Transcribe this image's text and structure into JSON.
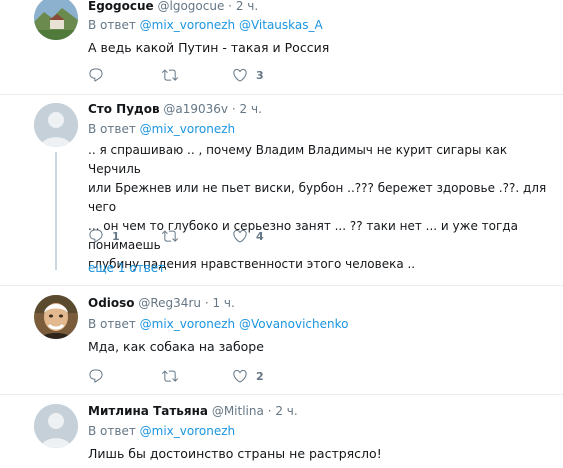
{
  "tweets": [
    {
      "name": "Egogocue",
      "handle": "@lgogocue",
      "dot": "·",
      "time": "2 ч.",
      "reply_prefix": "В ответ",
      "mentions": [
        "@mix_voronezh",
        "@Vitauskas_A"
      ],
      "text": "А ведь какой Путин - такая и Россия",
      "reply_count": "",
      "retweet_count": "",
      "like_count": "3"
    },
    {
      "name": "Сто Пудов",
      "handle": "@a19036v",
      "dot": "·",
      "time": "2 ч.",
      "reply_prefix": "В ответ",
      "mentions": [
        "@mix_voronezh"
      ],
      "text_lines": [
        ".. я спрашиваю ..  , почему Владим Владимыч не курит сигары как Черчиль",
        "или Брежнев или не пьет виски, бурбон ..??? бережет здоровье .??. для чего",
        "... он чем то глубоко и серьезно занят ... ?? таки нет ... и уже тогда понимаешь",
        "глубину падения нравственности этого человека .."
      ],
      "reply_count": "1",
      "retweet_count": "",
      "like_count": "4",
      "more_replies": "еще 1 ответ"
    },
    {
      "name": "Odioso",
      "handle": "@Reg34ru",
      "dot": "·",
      "time": "1 ч.",
      "reply_prefix": "В ответ",
      "mentions": [
        "@mix_voronezh",
        "@Vovanovichenko"
      ],
      "text": "Мда, как собака на заборе",
      "reply_count": "",
      "retweet_count": "",
      "like_count": "2"
    },
    {
      "name": "Митлина Татьяна",
      "handle": "@Mitlina",
      "dot": "·",
      "time": "2 ч.",
      "reply_prefix": "В ответ",
      "mentions": [
        "@mix_voronezh"
      ],
      "text": "Лишь бы достоинство страны не растрясло!"
    }
  ],
  "icons": {
    "reply": "reply-icon",
    "retweet": "retweet-icon",
    "like": "heart-icon"
  },
  "colors": {
    "link": "#1b95e0",
    "muted": "#657786",
    "separator": "#e6ecf0"
  }
}
